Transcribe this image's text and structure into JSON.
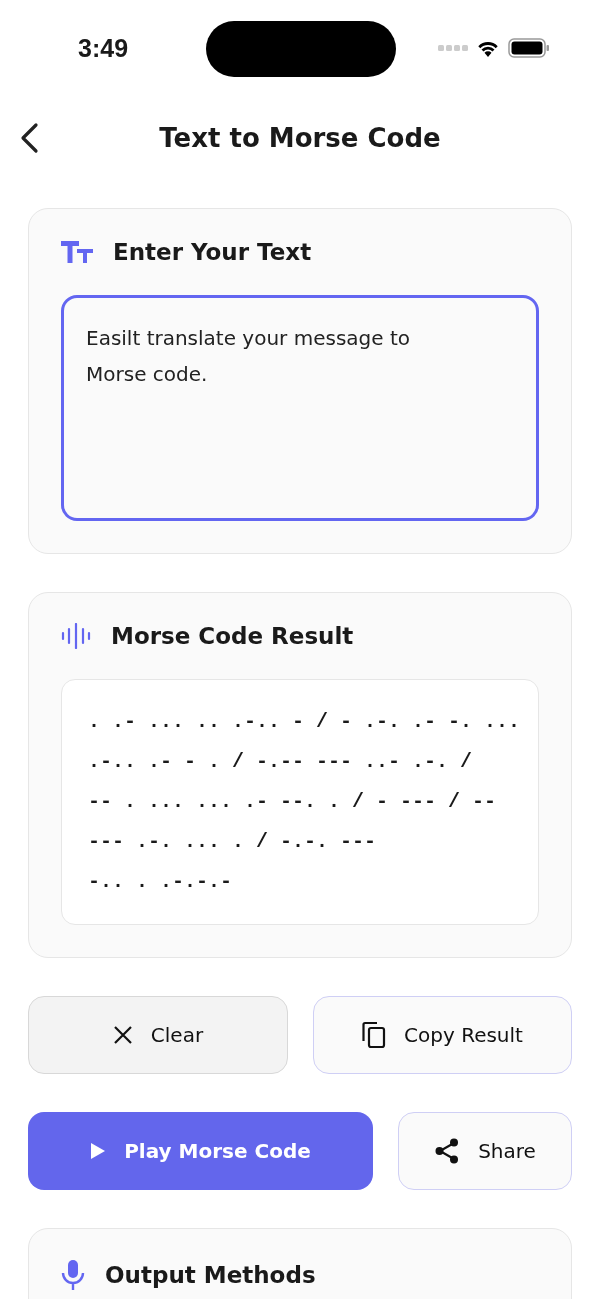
{
  "status_bar": {
    "time": "3:49"
  },
  "header": {
    "title": "Text to Morse Code"
  },
  "input_card": {
    "title": "Enter Your Text",
    "value": "Easilt translate your message to Morse code."
  },
  "result_card": {
    "title": "Morse Code Result",
    "lines": [
      ". .- ... .. .-.. - / - .-. .- -. ...",
      ".-.. .- - . / -.-- --- ..- .-. /",
      "-- . ... ... .- --. . / - --- / --",
      "--- .-. ... . / -.-. ---",
      "-.. . .-.-.-"
    ]
  },
  "actions": [
    {
      "label": "Clear",
      "kind": "clear"
    },
    {
      "label": "Copy Result",
      "kind": "copy"
    },
    {
      "label": "Play Morse Code",
      "kind": "play"
    },
    {
      "label": "Share",
      "kind": "share"
    }
  ],
  "output_card": {
    "title": "Output Methods"
  }
}
